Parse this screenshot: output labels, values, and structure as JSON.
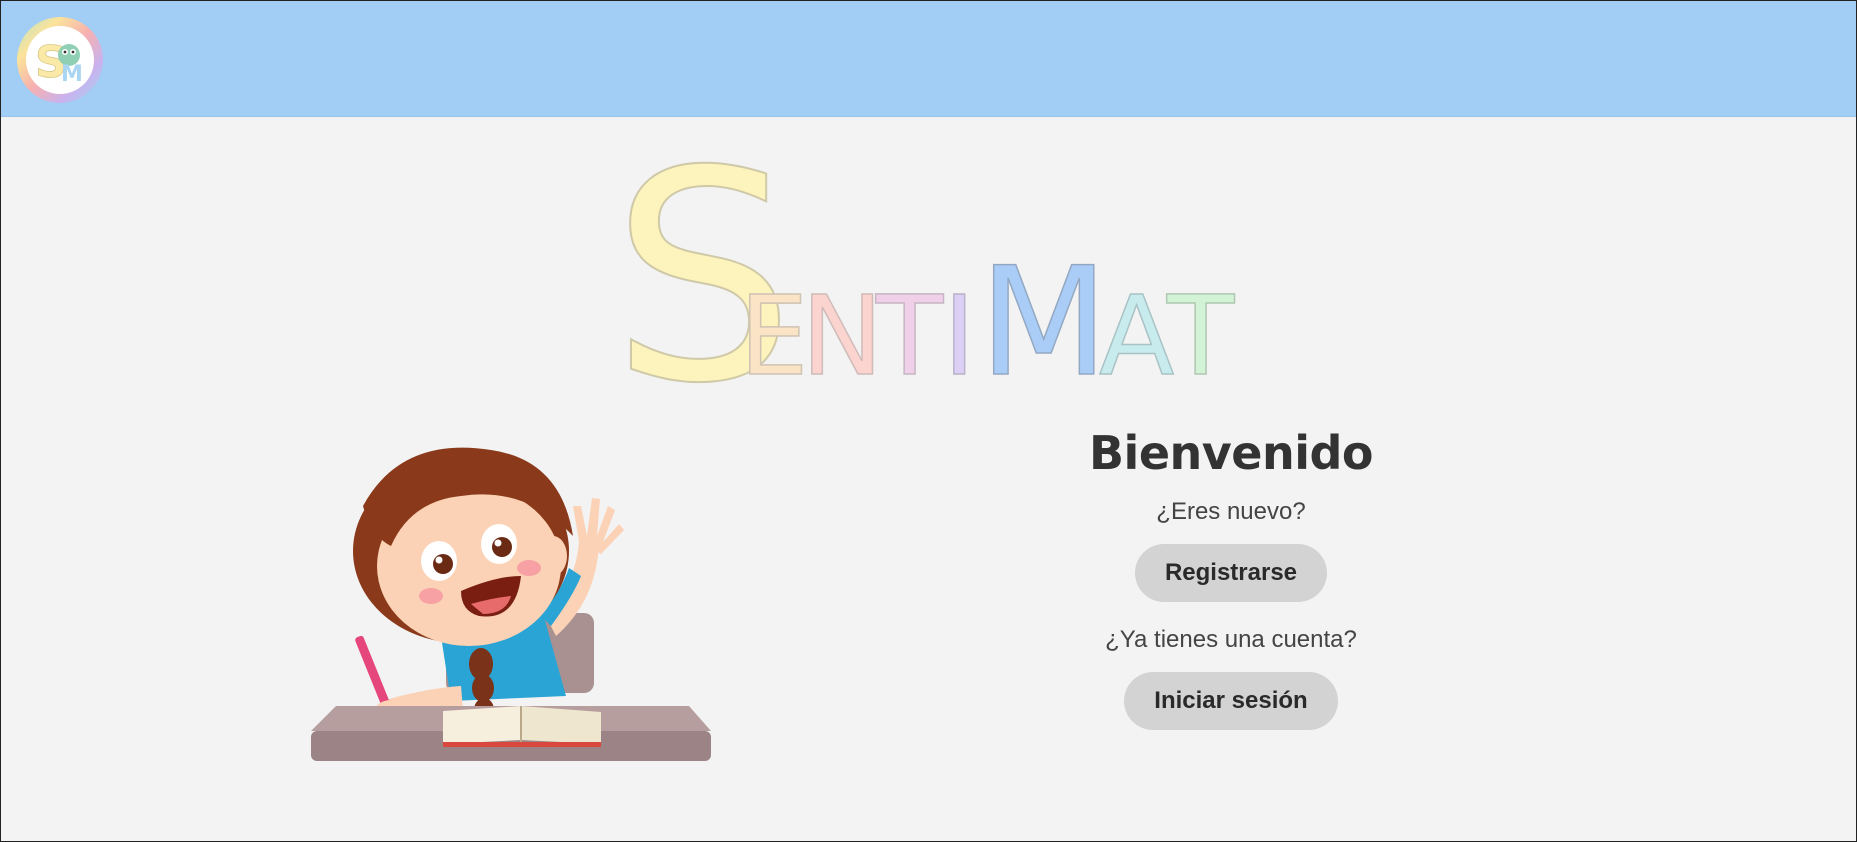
{
  "header": {
    "logo_icon": "sentimat-badge-icon",
    "logo_letters": "SM"
  },
  "brand": {
    "title": "SentiMat",
    "letters": [
      "S",
      "E",
      "N",
      "T",
      "I",
      "M",
      "A",
      "T"
    ]
  },
  "hero": {
    "icon": "girl-at-desk-raising-hand-illustration"
  },
  "welcome": {
    "heading": "Bienvenido",
    "new_prompt": "¿Eres nuevo?",
    "register_label": "Registrarse",
    "account_prompt": "¿Ya tienes una cuenta?",
    "login_label": "Iniciar sesión"
  },
  "colors": {
    "topbar": "#a2cdf5",
    "background": "#f3f3f3",
    "button": "#d3d3d3"
  }
}
